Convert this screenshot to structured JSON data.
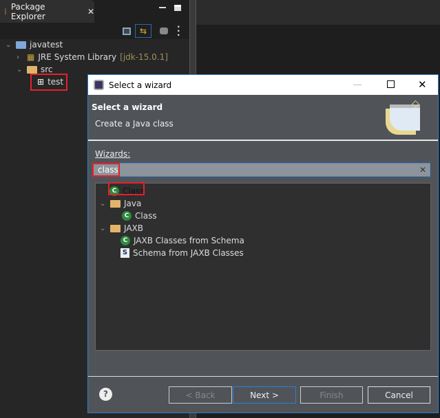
{
  "explorer": {
    "tab_label": "Package Explorer",
    "tree": [
      {
        "label": "javatest"
      },
      {
        "label": "JRE System Library",
        "decoration": "[jdk-15.0.1]"
      },
      {
        "label": "src"
      },
      {
        "label": "test"
      }
    ]
  },
  "dialog": {
    "title": "Select a wizard",
    "header_title": "Select a wizard",
    "header_desc": "Create a Java class",
    "wizards_label": "Wizards:",
    "filter_value": "class",
    "items": [
      {
        "label": "Class"
      },
      {
        "label": "Java"
      },
      {
        "label": "Class"
      },
      {
        "label": "JAXB"
      },
      {
        "label": "JAXB Classes from Schema"
      },
      {
        "label": "Schema from JAXB Classes"
      }
    ],
    "buttons": {
      "back": "< Back",
      "next": "Next >",
      "finish": "Finish",
      "cancel": "Cancel"
    }
  },
  "colors": {
    "highlight": "#e8202a",
    "focus": "#2a7fd4"
  }
}
